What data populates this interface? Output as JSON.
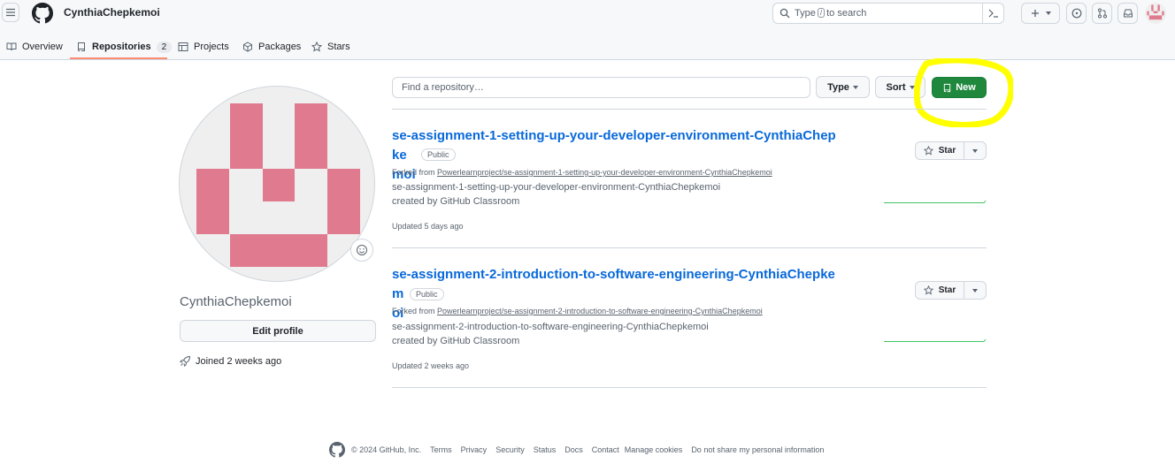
{
  "header": {
    "username": "CynthiaChepkemoi",
    "search_prefix": "Type",
    "search_key": "/",
    "search_suffix": "to search"
  },
  "tabs": [
    {
      "label": "Overview"
    },
    {
      "label": "Repositories",
      "count": "2",
      "selected": true
    },
    {
      "label": "Projects"
    },
    {
      "label": "Packages"
    },
    {
      "label": "Stars"
    }
  ],
  "profile": {
    "name": "CynthiaChepkemoi",
    "edit_label": "Edit profile",
    "joined": "Joined 2 weeks ago",
    "avatar_color": "#e07b8f"
  },
  "toolbar": {
    "find_placeholder": "Find a repository…",
    "type_label": "Type",
    "sort_label": "Sort",
    "new_label": "New"
  },
  "repos": [
    {
      "title_line1": "se-assignment-1-setting-up-your-developer-environment-CynthiaChepke",
      "title_line2": "moi",
      "visibility": "Public",
      "forked_prefix": "Forked from",
      "forked_from": "Powerlearnproject/se-assignment-1-setting-up-your-developer-environment-CynthiaChepkemoi",
      "desc_line1": "se-assignment-1-setting-up-your-developer-environment-CynthiaChepkemoi",
      "desc_line2": "created by GitHub Classroom",
      "updated": "Updated 5 days ago",
      "star_label": "Star"
    },
    {
      "title_line1": "se-assignment-2-introduction-to-software-engineering-CynthiaChepkem",
      "title_line2": "oi",
      "visibility": "Public",
      "forked_prefix": "Forked from",
      "forked_from": "Powerlearnproject/se-assignment-2-introduction-to-software-engineering-CynthiaChepkemoi",
      "desc_line1": "se-assignment-2-introduction-to-software-engineering-CynthiaChepkemoi",
      "desc_line2": "created by GitHub Classroom",
      "updated": "Updated 2 weeks ago",
      "star_label": "Star"
    }
  ],
  "footer": {
    "copyright": "© 2024 GitHub, Inc.",
    "links": [
      "Terms",
      "Privacy",
      "Security",
      "Status",
      "Docs",
      "Contact",
      "Manage cookies",
      "Do not share my personal information"
    ]
  },
  "colors": {
    "accent_green": "#1f883d",
    "link_blue": "#0969da",
    "tab_underline": "#fd8c73",
    "highlight_yellow": "#ffff00"
  }
}
